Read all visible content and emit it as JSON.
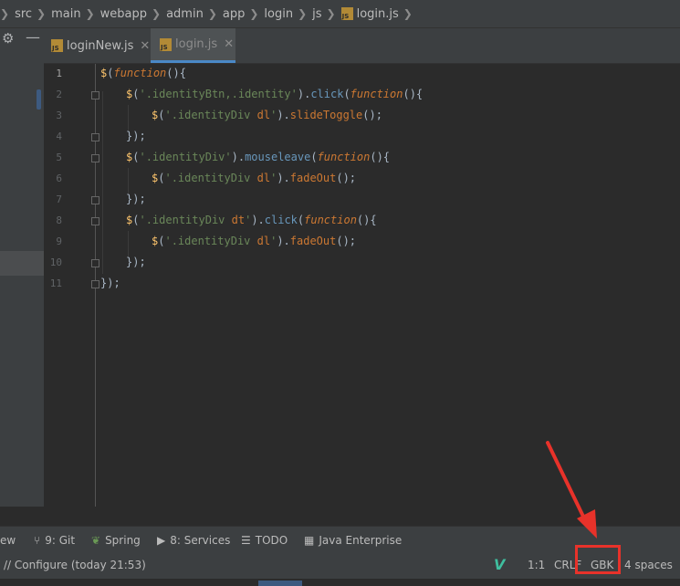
{
  "breadcrumb": {
    "items": [
      "src",
      "main",
      "webapp",
      "admin",
      "app",
      "login",
      "js",
      "login.js"
    ],
    "file_icon": "js-file-icon"
  },
  "tabs": [
    {
      "label": "loginNew.js",
      "active": false
    },
    {
      "label": "login.js",
      "active": true
    }
  ],
  "editor": {
    "line_numbers": [
      "1",
      "2",
      "3",
      "4",
      "5",
      "6",
      "7",
      "8",
      "9",
      "10",
      "11"
    ],
    "current_line": 1
  },
  "toolbar": {
    "items": [
      "ew",
      "9: Git",
      "Spring",
      "8: Services",
      "TODO",
      "Java Enterprise"
    ]
  },
  "status": {
    "message": "// Configure (today 21:53)",
    "position": "1:1",
    "line_sep": "CRLF",
    "encoding": "GBK",
    "indent": "4 spaces"
  },
  "colors": {
    "annotation": "#e8322a",
    "accent": "#4a88c7"
  }
}
